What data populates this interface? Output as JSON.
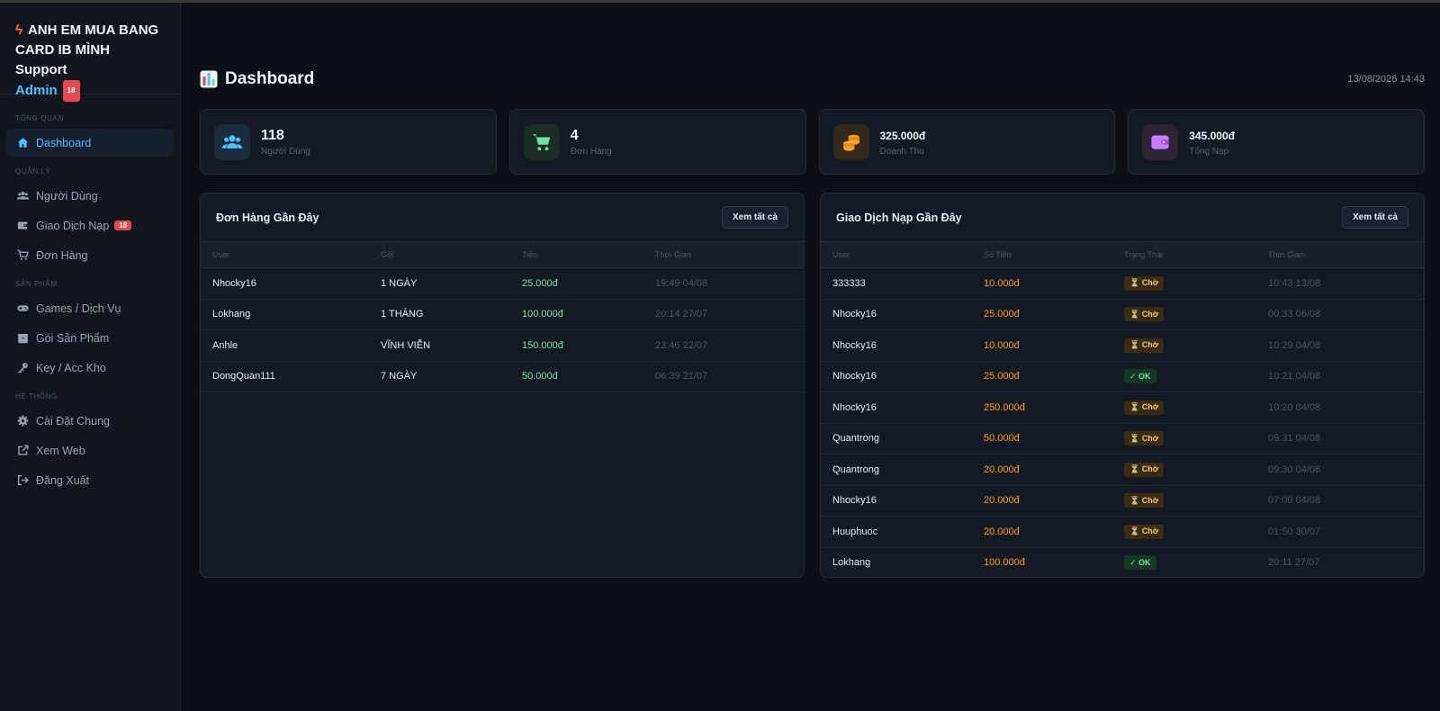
{
  "sidebar": {
    "brand_line1": "ANH EM MUA BANG",
    "brand_line2": "CARD IB MÌNH Support",
    "brand_admin": "Admin",
    "brand_badge": "18",
    "sections": {
      "overview": "TỔNG QUAN",
      "manage": "QUẢN LÝ",
      "products": "SẢN PHẨM",
      "system": "HỆ THỐNG"
    },
    "items": {
      "dashboard": "Dashboard",
      "users": "Người Dùng",
      "topups": "Giao Dịch Nạp",
      "topups_badge": "18",
      "orders": "Đơn Hàng",
      "games": "Games / Dịch Vụ",
      "packages": "Gói Sản Phẩm",
      "keys": "Key / Acc Kho",
      "settings": "Cài Đặt Chung",
      "view_web": "Xem Web",
      "logout": "Đăng Xuất"
    }
  },
  "header": {
    "title": "Dashboard",
    "datetime": "13/08/2026 14:43"
  },
  "stats": [
    {
      "value": "118",
      "label": "Người Dùng",
      "icon": "users-icon",
      "color": "#4cc2ff"
    },
    {
      "value": "4",
      "label": "Đơn Hàng",
      "icon": "cart-icon",
      "color": "#6ee19c"
    },
    {
      "value": "325.000đ",
      "label": "Doanh Thu",
      "icon": "coins-icon",
      "color": "#ff9f1c"
    },
    {
      "value": "345.000đ",
      "label": "Tổng Nạp",
      "icon": "wallet-icon",
      "color": "#c77dff"
    }
  ],
  "orders_panel": {
    "title": "Đơn Hàng Gần Đây",
    "view_all": "Xem tất cả",
    "columns": [
      "User",
      "Gói",
      "Tiền",
      "Thời Gian"
    ],
    "rows": [
      {
        "user": "Nhocky16",
        "package": "1 NGÀY",
        "amount": "25.000đ",
        "time": "19:49 04/08"
      },
      {
        "user": "Lokhang",
        "package": "1 THÁNG",
        "amount": "100.000đ",
        "time": "20:14 27/07"
      },
      {
        "user": "Anhle",
        "package": "VĨNH VIỄN",
        "amount": "150.000đ",
        "time": "23:46 22/07"
      },
      {
        "user": "DongQuan111",
        "package": "7 NGÀY",
        "amount": "50.000đ",
        "time": "06:39 21/07"
      }
    ]
  },
  "topups_panel": {
    "title": "Giao Dịch Nạp Gần Đây",
    "view_all": "Xem tất cả",
    "columns": [
      "User",
      "Số Tiền",
      "Trạng Thái",
      "Thời Gian"
    ],
    "rows": [
      {
        "user": "333333",
        "amount": "10.000đ",
        "status": "⏳ Chờ",
        "state": "wait",
        "time": "10:43 13/08"
      },
      {
        "user": "Nhocky16",
        "amount": "25.000đ",
        "status": "⏳ Chờ",
        "state": "wait",
        "time": "00:33 06/08"
      },
      {
        "user": "Nhocky16",
        "amount": "10.000đ",
        "status": "⏳ Chờ",
        "state": "wait",
        "time": "10:29 04/08"
      },
      {
        "user": "Nhocky16",
        "amount": "25.000đ",
        "status": "✓ OK",
        "state": "ok",
        "time": "10:21 04/08"
      },
      {
        "user": "Nhocky16",
        "amount": "250.000đ",
        "status": "⏳ Chờ",
        "state": "wait",
        "time": "10:20 04/08"
      },
      {
        "user": "Quantrong",
        "amount": "50.000đ",
        "status": "⏳ Chờ",
        "state": "wait",
        "time": "09:31 04/08"
      },
      {
        "user": "Quantrong",
        "amount": "20.000đ",
        "status": "⏳ Chờ",
        "state": "wait",
        "time": "09:30 04/08"
      },
      {
        "user": "Nhocky16",
        "amount": "20.000đ",
        "status": "⏳ Chờ",
        "state": "wait",
        "time": "07:00 04/08"
      },
      {
        "user": "Huuphuoc",
        "amount": "20.000đ",
        "status": "⏳ Chờ",
        "state": "wait",
        "time": "01:50 30/07"
      },
      {
        "user": "Lokhang",
        "amount": "100.000đ",
        "status": "✓ OK",
        "state": "ok",
        "time": "20:11 27/07"
      }
    ]
  }
}
